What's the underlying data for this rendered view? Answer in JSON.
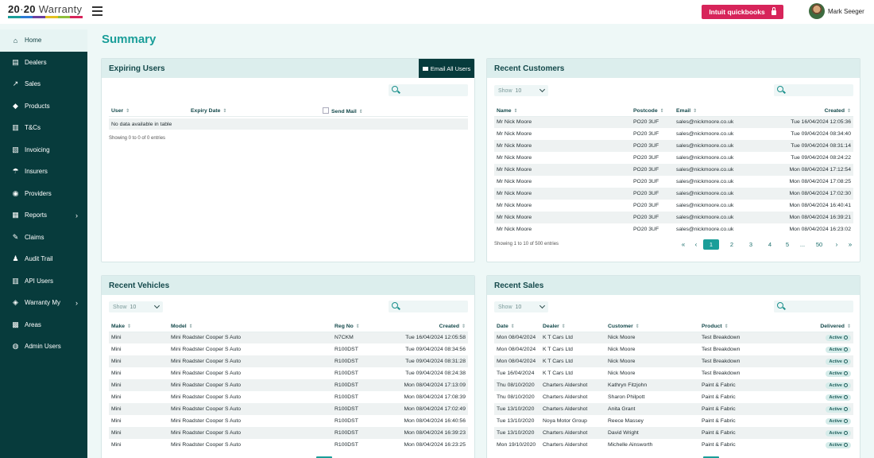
{
  "app": {
    "logo_a": "20",
    "logo_sep": "·",
    "logo_b": "20",
    "logo_c": "Warranty",
    "stripe_colors": [
      "#1a9e99",
      "#2c7bd6",
      "#6b3fa0",
      "#e4c021",
      "#8fbf3a",
      "#d7245a"
    ],
    "page_title": "Summary"
  },
  "header": {
    "quickbooks_label": "Intuit quickbooks",
    "user_name": "Mark Seeger"
  },
  "sidebar": {
    "items": [
      {
        "label": "Home",
        "icon": "home-icon",
        "glyph": "⌂",
        "active": true
      },
      {
        "label": "Dealers",
        "icon": "dealers-icon",
        "glyph": "▤",
        "active": false
      },
      {
        "label": "Sales",
        "icon": "chart-line-icon",
        "glyph": "↗",
        "active": false
      },
      {
        "label": "Products",
        "icon": "car-icon",
        "glyph": "◆",
        "active": false
      },
      {
        "label": "T&Cs",
        "icon": "documents-icon",
        "glyph": "▥",
        "active": false
      },
      {
        "label": "Invoicing",
        "icon": "invoice-icon",
        "glyph": "▧",
        "active": false
      },
      {
        "label": "Insurers",
        "icon": "umbrella-icon",
        "glyph": "☂",
        "active": false
      },
      {
        "label": "Providers",
        "icon": "users-icon",
        "glyph": "◉",
        "active": false
      },
      {
        "label": "Reports",
        "icon": "report-icon",
        "glyph": "▦",
        "active": false,
        "chevron": "›"
      },
      {
        "label": "Claims",
        "icon": "claims-icon",
        "glyph": "✎",
        "active": false
      },
      {
        "label": "Audit Trail",
        "icon": "audit-icon",
        "glyph": "♟",
        "active": false
      },
      {
        "label": "API Users",
        "icon": "bank-icon",
        "glyph": "▥",
        "active": false
      },
      {
        "label": "Warranty My",
        "icon": "shield-icon",
        "glyph": "◈",
        "active": false,
        "chevron": "›"
      },
      {
        "label": "Areas",
        "icon": "map-icon",
        "glyph": "▩",
        "active": false
      },
      {
        "label": "Admin Users",
        "icon": "admin-users-icon",
        "glyph": "◍",
        "active": false
      }
    ]
  },
  "expiring_users": {
    "title": "Expiring Users",
    "email_all_label": "Email All Users",
    "columns": [
      "User",
      "Expiry Date",
      "Send Mail"
    ],
    "empty_text": "No data available in table",
    "info": "Showing 0 to 0 of 0 entries"
  },
  "recent_customers": {
    "title": "Recent Customers",
    "show_label": "Show",
    "show_value": "10",
    "columns": [
      "Name",
      "Postcode",
      "Email",
      "Created"
    ],
    "rows": [
      [
        "Mr Nick Moore",
        "PO20 3UF",
        "sales@nickmoore.co.uk",
        "Tue 16/04/2024 12:05:36"
      ],
      [
        "Mr Nick Moore",
        "PO20 3UF",
        "sales@nickmoore.co.uk",
        "Tue 09/04/2024 08:34:40"
      ],
      [
        "Mr Nick Moore",
        "PO20 3UF",
        "sales@nickmoore.co.uk",
        "Tue 09/04/2024 08:31:14"
      ],
      [
        "Mr Nick Moore",
        "PO20 3UF",
        "sales@nickmoore.co.uk",
        "Tue 09/04/2024 08:24:22"
      ],
      [
        "Mr Nick Moore",
        "PO20 3UF",
        "sales@nickmoore.co.uk",
        "Mon 08/04/2024 17:12:54"
      ],
      [
        "Mr Nick Moore",
        "PO20 3UF",
        "sales@nickmoore.co.uk",
        "Mon 08/04/2024 17:08:25"
      ],
      [
        "Mr Nick Moore",
        "PO20 3UF",
        "sales@nickmoore.co.uk",
        "Mon 08/04/2024 17:02:30"
      ],
      [
        "Mr Nick Moore",
        "PO20 3UF",
        "sales@nickmoore.co.uk",
        "Mon 08/04/2024 16:40:41"
      ],
      [
        "Mr Nick Moore",
        "PO20 3UF",
        "sales@nickmoore.co.uk",
        "Mon 08/04/2024 16:39:21"
      ],
      [
        "Mr Nick Moore",
        "PO20 3UF",
        "sales@nickmoore.co.uk",
        "Mon 08/04/2024 16:23:02"
      ]
    ],
    "info": "Showing 1 to 10 of 500 entries",
    "pagination": [
      "«",
      "‹",
      "1",
      "2",
      "3",
      "4",
      "5",
      "...",
      "50",
      "›",
      "»"
    ],
    "current_page": "1"
  },
  "recent_vehicles": {
    "title": "Recent Vehicles",
    "show_label": "Show",
    "show_value": "10",
    "columns": [
      "Make",
      "Model",
      "Reg No",
      "Created"
    ],
    "rows": [
      [
        "Mini",
        "Mini Roadster Cooper S Auto",
        "N7CKM",
        "Tue 16/04/2024 12:05:58"
      ],
      [
        "Mini",
        "Mini Roadster Cooper S Auto",
        "R100DST",
        "Tue 09/04/2024 08:34:56"
      ],
      [
        "Mini",
        "Mini Roadster Cooper S Auto",
        "R100DST",
        "Tue 09/04/2024 08:31:28"
      ],
      [
        "Mini",
        "Mini Roadster Cooper S Auto",
        "R100DST",
        "Tue 09/04/2024 08:24:38"
      ],
      [
        "Mini",
        "Mini Roadster Cooper S Auto",
        "R100DST",
        "Mon 08/04/2024 17:13:09"
      ],
      [
        "Mini",
        "Mini Roadster Cooper S Auto",
        "R100DST",
        "Mon 08/04/2024 17:08:39"
      ],
      [
        "Mini",
        "Mini Roadster Cooper S Auto",
        "R100DST",
        "Mon 08/04/2024 17:02:49"
      ],
      [
        "Mini",
        "Mini Roadster Cooper S Auto",
        "R100DST",
        "Mon 08/04/2024 16:40:56"
      ],
      [
        "Mini",
        "Mini Roadster Cooper S Auto",
        "R100DST",
        "Mon 08/04/2024 16:39:23"
      ],
      [
        "Mini",
        "Mini Roadster Cooper S Auto",
        "R100DST",
        "Mon 08/04/2024 16:23:25"
      ]
    ]
  },
  "recent_sales": {
    "title": "Recent Sales",
    "show_label": "Show",
    "show_value": "10",
    "columns": [
      "Date",
      "Dealer",
      "Customer",
      "Product",
      "Delivered"
    ],
    "rows": [
      [
        "Mon 08/04/2024",
        "K T Cars Ltd",
        "Nick Moore",
        "Test Breakdown",
        "Active"
      ],
      [
        "Mon 08/04/2024",
        "K T Cars Ltd",
        "Nick Moore",
        "Test Breakdown",
        "Active"
      ],
      [
        "Mon 08/04/2024",
        "K T Cars Ltd",
        "Nick Moore",
        "Test Breakdown",
        "Active"
      ],
      [
        "Tue 16/04/2024",
        "K T Cars Ltd",
        "Nick Moore",
        "Test Breakdown",
        "Active"
      ],
      [
        "Thu 08/10/2020",
        "Charters Aldershot",
        "Kathryn Fitzjohn",
        "Paint & Fabric",
        "Active"
      ],
      [
        "Thu 08/10/2020",
        "Charters Aldershot",
        "Sharon Philpott",
        "Paint & Fabric",
        "Active"
      ],
      [
        "Tue 13/10/2020",
        "Charters Aldershot",
        "Anita Grant",
        "Paint & Fabric",
        "Active"
      ],
      [
        "Tue 13/10/2020",
        "Noya Motor Group",
        "Reece Massey",
        "Paint & Fabric",
        "Active"
      ],
      [
        "Tue 13/10/2020",
        "Charters Aldershot",
        "David Wright",
        "Paint & Fabric",
        "Active"
      ],
      [
        "Mon 19/10/2020",
        "Charters Aldershot",
        "Michelle Ainsworth",
        "Paint & Fabric",
        "Active"
      ]
    ]
  },
  "colors": {
    "accent": "#1a9e99",
    "sidebar": "#073b3c",
    "quickbooks": "#d7245a"
  }
}
